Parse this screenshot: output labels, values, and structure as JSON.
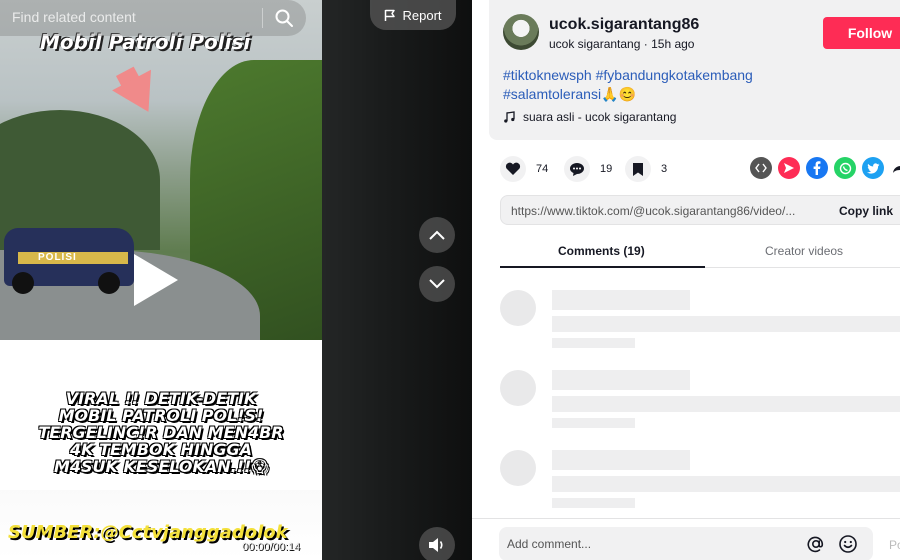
{
  "search": {
    "placeholder": "Find related content"
  },
  "report": {
    "label": "Report"
  },
  "video": {
    "title_overlay": "Mobil Patroli Polisi",
    "car_label": "POLISI",
    "caption_lines": [
      "VIRAL !! DETIK-DETIK",
      "MOBIL PATROLI POL!S!",
      "TERGELINC!R DAN MEN4BR",
      "4K TEMBOK HINGGA",
      "M4SUK KESELOKAN.!!😱"
    ],
    "source": "SUMBER:@Cctvjanggadolok",
    "time": "00:00/00:14"
  },
  "author": {
    "username": "ucok.sigarantang86",
    "display_name": "ucok sigarantang",
    "posted": "15h ago",
    "follow_label": "Follow"
  },
  "description": {
    "hashtags": [
      "#tiktoknewsph",
      "#fybandungkotakembang",
      "#salamtoleransi🙏😊"
    ],
    "music": "suara asli - ucok sigarantang"
  },
  "actions": {
    "likes": "74",
    "comments": "19",
    "saves": "3"
  },
  "share_icons": [
    "embed-icon",
    "send-icon",
    "facebook-icon",
    "whatsapp-icon",
    "twitter-icon",
    "share-arrow-icon"
  ],
  "colors": {
    "follow": "#fe2c55",
    "hashtag": "#2b5db9",
    "facebook": "#1877f2",
    "whatsapp": "#25d366",
    "twitter": "#1da1f2",
    "send": "#fe2c55"
  },
  "link": {
    "url": "https://www.tiktok.com/@ucok.sigarantang86/video/...",
    "copy_label": "Copy link"
  },
  "tabs": {
    "comments": "Comments (19)",
    "creator": "Creator videos"
  },
  "comment_input": {
    "placeholder": "Add comment...",
    "post_label": "Po"
  }
}
